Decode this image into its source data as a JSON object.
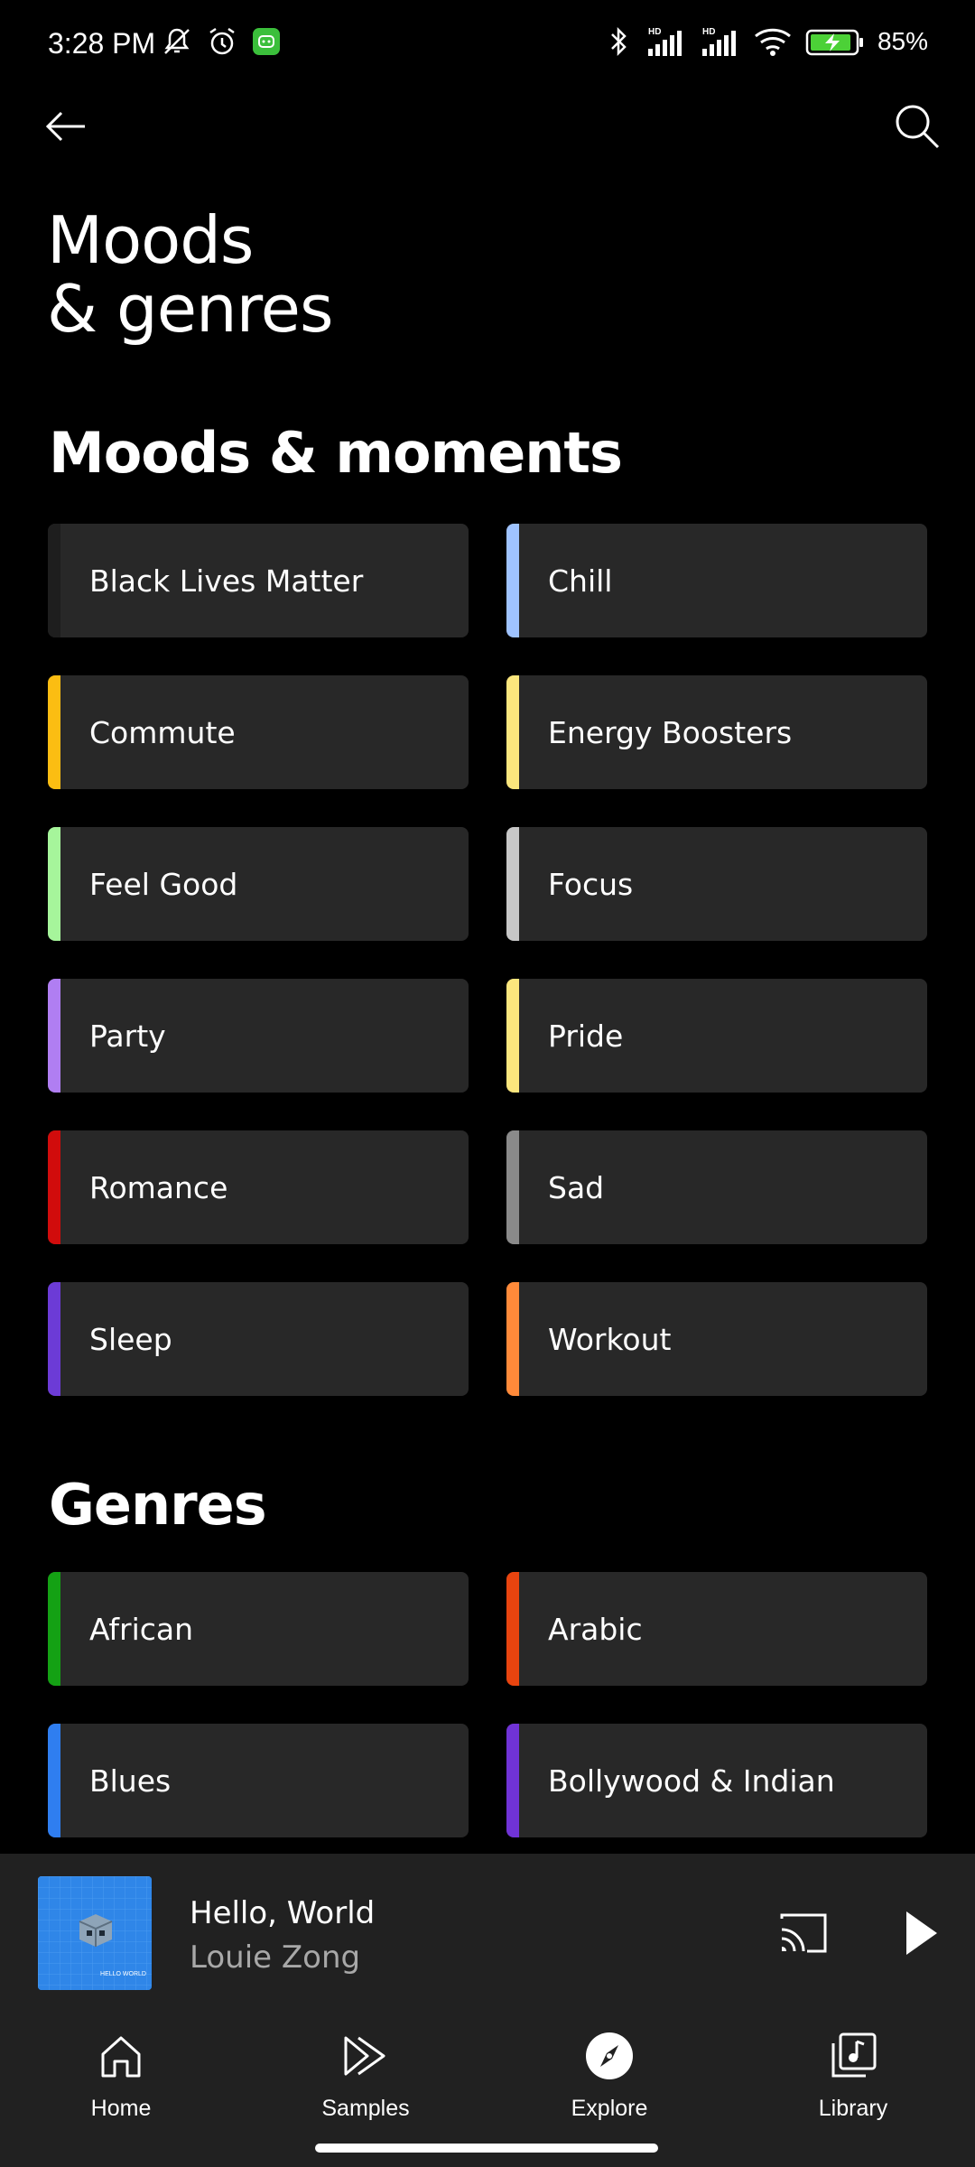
{
  "status_bar": {
    "time": "3:28 PM",
    "battery": "85%",
    "icons": [
      "mute-icon",
      "alarm-icon",
      "app-notification-icon",
      "bluetooth-icon",
      "signal-hd-icon",
      "signal-hd-icon",
      "wifi-icon",
      "battery-charging-icon"
    ]
  },
  "header": {
    "title_line1": "Moods",
    "title_line2": "& genres"
  },
  "moods": {
    "heading": "Moods & moments",
    "items": [
      {
        "label": "Black Lives Matter",
        "color": "#1e1e1e"
      },
      {
        "label": "Chill",
        "color": "#9fc3ff"
      },
      {
        "label": "Commute",
        "color": "#fbbd12"
      },
      {
        "label": "Energy Boosters",
        "color": "#fbe67d"
      },
      {
        "label": "Feel Good",
        "color": "#a6f59b"
      },
      {
        "label": "Focus",
        "color": "#c7c7c7"
      },
      {
        "label": "Party",
        "color": "#b07ef2"
      },
      {
        "label": "Pride",
        "color": "#fbe67d"
      },
      {
        "label": "Romance",
        "color": "#d10c0c"
      },
      {
        "label": "Sad",
        "color": "#8a8a8a"
      },
      {
        "label": "Sleep",
        "color": "#6c3bd6"
      },
      {
        "label": "Workout",
        "color": "#ff8a3a"
      }
    ]
  },
  "genres": {
    "heading": "Genres",
    "items": [
      {
        "label": "African",
        "color": "#14a114"
      },
      {
        "label": "Arabic",
        "color": "#e8440f"
      },
      {
        "label": "Blues",
        "color": "#2f7ef0"
      },
      {
        "label": "Bollywood & Indian",
        "color": "#7033d6"
      }
    ]
  },
  "player": {
    "title": "Hello, World",
    "artist": "Louie Zong",
    "art_text": "HELLO WORLD"
  },
  "nav": {
    "home": "Home",
    "samples": "Samples",
    "explore": "Explore",
    "library": "Library"
  }
}
